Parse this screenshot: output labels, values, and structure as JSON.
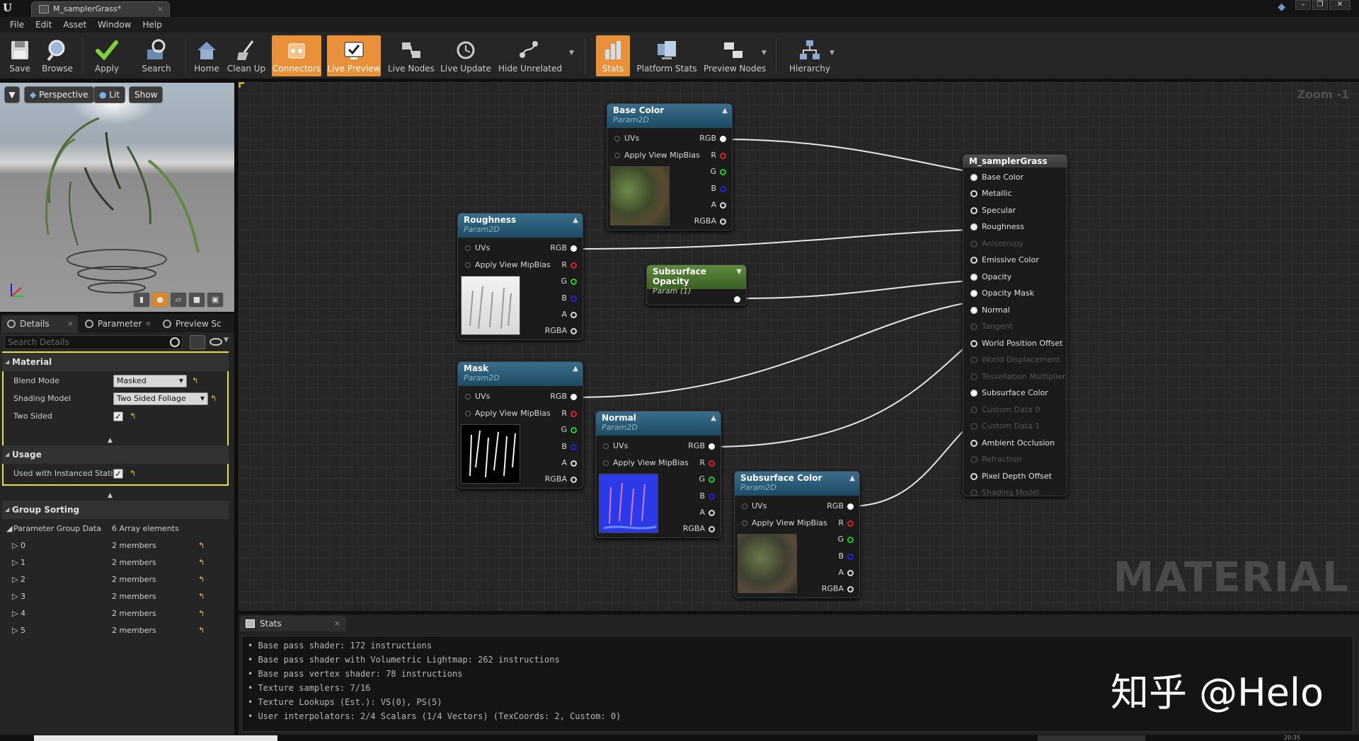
{
  "window": {
    "tab_title": "M_samplerGrass*",
    "logo": "U"
  },
  "menu": [
    "File",
    "Edit",
    "Asset",
    "Window",
    "Help"
  ],
  "toolbar": {
    "save": "Save",
    "browse": "Browse",
    "apply": "Apply",
    "search": "Search",
    "home": "Home",
    "cleanup": "Clean Up",
    "connectors": "Connectors",
    "live_preview": "Live Preview",
    "live_nodes": "Live Nodes",
    "live_update": "Live Update",
    "hide_unrelated": "Hide Unrelated",
    "stats": "Stats",
    "platform_stats": "Platform Stats",
    "preview_nodes": "Preview Nodes",
    "hierarchy": "Hierarchy"
  },
  "viewport": {
    "perspective": "Perspective",
    "lit": "Lit",
    "show": "Show"
  },
  "details": {
    "tabs": [
      "Details",
      "Parameter",
      "Preview Sc"
    ],
    "search_placeholder": "Search Details",
    "material": {
      "header": "Material",
      "blend_mode_label": "Blend Mode",
      "blend_mode_value": "Masked",
      "shading_model_label": "Shading Model",
      "shading_model_value": "Two Sided Foliage",
      "two_sided_label": "Two Sided"
    },
    "usage": {
      "header": "Usage",
      "instanced_label": "Used with Instanced Static"
    },
    "group_sorting": {
      "header": "Group Sorting",
      "param_group_label": "Parameter Group Data",
      "param_group_value": "6 Array elements",
      "items": [
        {
          "i": "0",
          "v": "2 members"
        },
        {
          "i": "1",
          "v": "2 members"
        },
        {
          "i": "2",
          "v": "2 members"
        },
        {
          "i": "3",
          "v": "2 members"
        },
        {
          "i": "4",
          "v": "2 members"
        },
        {
          "i": "5",
          "v": "2 members"
        }
      ]
    }
  },
  "graph": {
    "zoom": "Zoom -1",
    "watermark": "MATERIAL",
    "nodes": {
      "base_color": {
        "title": "Base Color",
        "sub": "Param2D"
      },
      "roughness": {
        "title": "Roughness",
        "sub": "Param2D"
      },
      "subsurface_opacity": {
        "title": "Subsurface Opacity",
        "sub": "Param (1)"
      },
      "mask": {
        "title": "Mask",
        "sub": "Param2D"
      },
      "normal": {
        "title": "Normal",
        "sub": "Param2D"
      },
      "subsurface_color": {
        "title": "Subsurface Color",
        "sub": "Param2D"
      }
    },
    "pins": {
      "uvs": "UVs",
      "mip": "Apply View MipBias",
      "rgb": "RGB",
      "r": "R",
      "g": "G",
      "b": "B",
      "a": "A",
      "rgba": "RGBA"
    },
    "result": {
      "title": "M_samplerGrass",
      "inputs": [
        "Base Color",
        "Metallic",
        "Specular",
        "Roughness",
        "Anisotropy",
        "Emissive Color",
        "Opacity",
        "Opacity Mask",
        "Normal",
        "Tangent",
        "World Position Offset",
        "World Displacement",
        "Tessellation Multiplier",
        "Subsurface Color",
        "Custom Data 0",
        "Custom Data 1",
        "Ambient Occlusion",
        "Refraction",
        "Pixel Depth Offset",
        "Shading Model"
      ]
    }
  },
  "stats": {
    "tab": "Stats",
    "lines": [
      "Base pass shader: 172 instructions",
      "Base pass shader with Volumetric Lightmap: 262 instructions",
      "Base pass vertex shader: 78 instructions",
      "Texture samplers: 7/16",
      "Texture Lookups (Est.): VS(0), PS(5)",
      "User interpolators: 2/4 Scalars (1/4 Vectors) (TexCoords: 2, Custom: 0)"
    ]
  },
  "overlay": {
    "zhihu": "知乎 @Helo"
  },
  "clock": "20:35"
}
